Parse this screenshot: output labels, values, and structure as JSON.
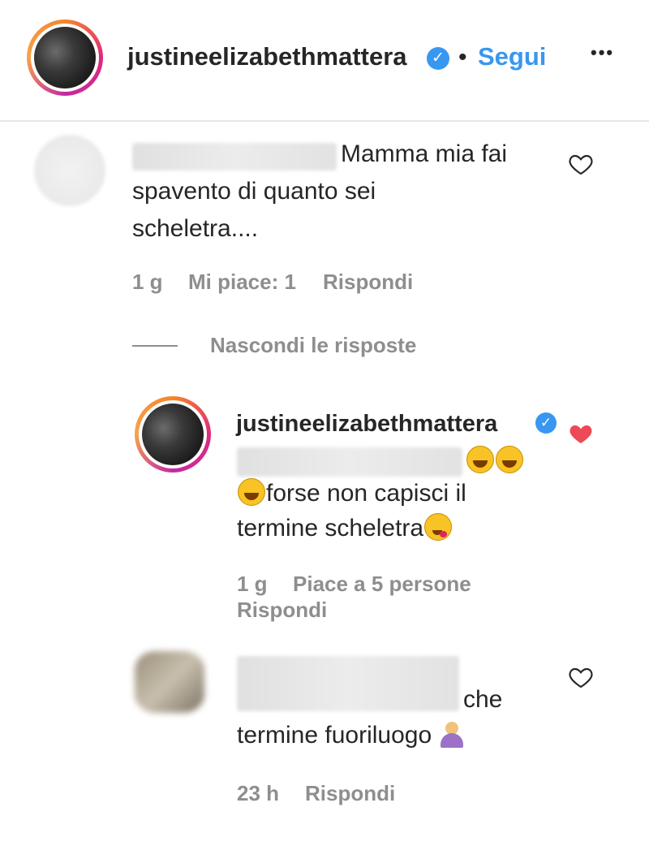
{
  "header": {
    "username": "justineelizabethmattera",
    "verified_mark": "✓",
    "separator": "•",
    "follow_label": "Segui",
    "more_label": "•••"
  },
  "comment1": {
    "text_line1": "Mamma mia fai",
    "text_line2": "spavento di quanto sei",
    "text_line3": "scheletra....",
    "time": "1 g",
    "likes": "Mi piace: 1",
    "reply_label": "Rispondi"
  },
  "replies_toggle": {
    "label": "Nascondi le risposte"
  },
  "reply1": {
    "username": "justineelizabethmattera",
    "verified_mark": "✓",
    "text_line2": "forse non capisci il",
    "text_line3": "termine scheletra",
    "time": "1 g",
    "likes": "Piace a 5 persone",
    "reply_label": "Rispondi"
  },
  "reply2": {
    "text_line1": "che",
    "text_line2": "termine fuoriluogo",
    "time": "23 h",
    "reply_label": "Rispondi"
  },
  "colors": {
    "accent_blue": "#3897f0",
    "liked_red": "#ed4956",
    "meta_gray": "#8e8e8e"
  },
  "icons": {
    "heart_outline": "heart-outline-icon",
    "heart_filled": "heart-filled-icon",
    "verified": "verified-badge-icon"
  }
}
